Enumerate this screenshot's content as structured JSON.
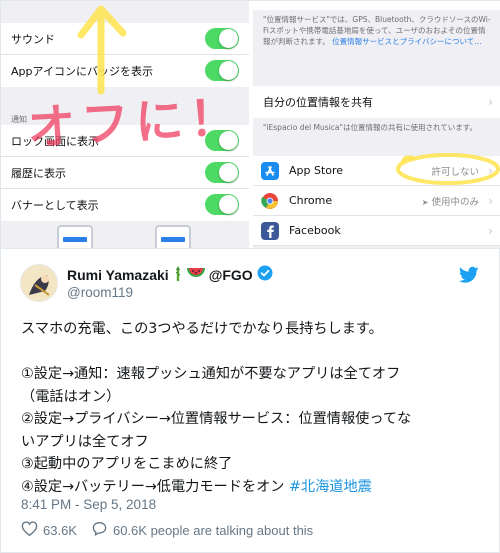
{
  "screenshot": {
    "left_panel": {
      "rows_top": [
        {
          "label": "サウンド",
          "toggle_on": true
        },
        {
          "label": "Appアイコンにバッジを表示",
          "toggle_on": true
        }
      ],
      "section_label": "通知",
      "rows_bottom": [
        {
          "label": "ロック画面に表示",
          "toggle_on": true
        },
        {
          "label": "履歴に表示",
          "toggle_on": true
        },
        {
          "label": "バナーとして表示",
          "toggle_on": true
        }
      ],
      "annotation_text": "オフに！",
      "annotation_color": "#f0395c",
      "arrow_color": "#ffe34d"
    },
    "right_panel": {
      "note_top": "\"位置情報サービス\"では、GPS、Bluetooth、クラウドソースのWi-Fiスポットや携帯電話基地局を使って、ユーザのおおよその位置情報が判断されます。",
      "note_top_link": "位置情報サービスとプライバシーについて…",
      "share_location_label": "自分の位置情報を共有",
      "share_note": "\"iEspacio del Musica\"は位置情報の共有に使用されています。",
      "apps": [
        {
          "name": "App Store",
          "value": "許可しない",
          "icon": "app-store-icon",
          "icon_color": "#1a8cf0"
        },
        {
          "name": "Chrome",
          "value": "使用中のみ",
          "icon": "chrome-icon",
          "icon_color": "#e8453c"
        },
        {
          "name": "Facebook",
          "value": "",
          "icon": "facebook-icon",
          "icon_color": "#3b5998"
        }
      ],
      "highlight_color": "#ffe34d"
    }
  },
  "tweet": {
    "author_name": "Rumi Yamazaki",
    "author_name_suffix": "@FGO",
    "handle": "@room119",
    "text_lines": [
      "スマホの充電、この3つやるだけでかなり長持ちします。",
      "",
      "①設定→通知：速報プッシュ通知が不要なアプリは全てオフ",
      "（電話はオン）",
      "②設定→プライバシー→位置情報サービス：位置情報使ってな",
      "いアプリは全てオフ",
      "③起動中のアプリをこまめに終了"
    ],
    "last_line_text": "④設定→バッテリー→低電力モードをオン ",
    "hashtag": "#北海道地震",
    "timestamp": "8:41 PM - Sep 5, 2018",
    "likes": "63.6K",
    "talking": "60.6K people are talking about this",
    "accent_color": "#1da1f2",
    "hashtag_color": "#1b95e0"
  }
}
